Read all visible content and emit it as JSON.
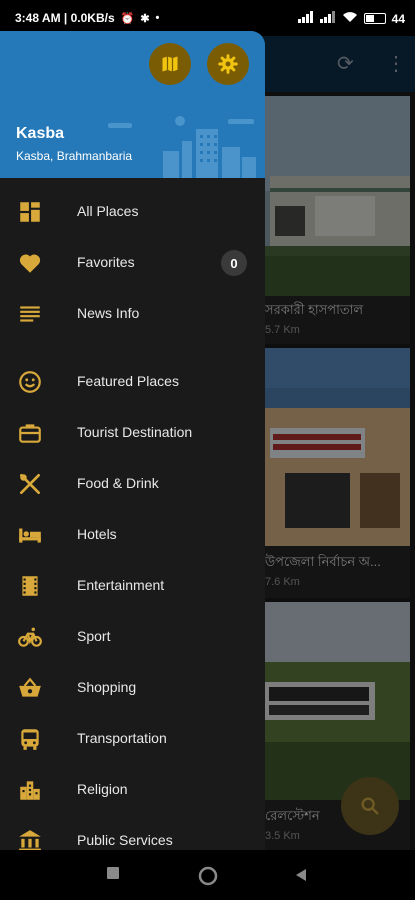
{
  "status_bar": {
    "time_info": "3:48 AM | 0.0KB/s",
    "battery": "44"
  },
  "drawer": {
    "header": {
      "title": "Kasba",
      "subtitle": "Kasba, Brahmanbaria"
    },
    "items": [
      {
        "label": "All Places",
        "icon": "grid-icon"
      },
      {
        "label": "Favorites",
        "icon": "heart-icon",
        "badge": "0"
      },
      {
        "label": "News Info",
        "icon": "news-lines-icon"
      },
      {
        "label": "Featured Places",
        "icon": "smiley-icon"
      },
      {
        "label": "Tourist Destination",
        "icon": "briefcase-icon"
      },
      {
        "label": "Food & Drink",
        "icon": "fork-knife-icon"
      },
      {
        "label": "Hotels",
        "icon": "bed-icon"
      },
      {
        "label": "Entertainment",
        "icon": "film-icon"
      },
      {
        "label": "Sport",
        "icon": "bicycle-icon"
      },
      {
        "label": "Shopping",
        "icon": "basket-icon"
      },
      {
        "label": "Transportation",
        "icon": "bus-icon"
      },
      {
        "label": "Religion",
        "icon": "city-icon"
      },
      {
        "label": "Public Services",
        "icon": "bank-icon"
      }
    ]
  },
  "background_cards": [
    {
      "title": "সরকারী হাসপাতাল",
      "distance": "5.7 Km"
    },
    {
      "title": "উপজেলা নির্বাচন অ...",
      "distance": "7.6 Km"
    },
    {
      "title": "রেলস্টেশন",
      "distance": "3.5 Km"
    }
  ],
  "colors": {
    "accent": "#f1c40f",
    "header": "#2679b8",
    "drawer_bg": "#1a1a1a",
    "icon": "#d8a93a"
  }
}
